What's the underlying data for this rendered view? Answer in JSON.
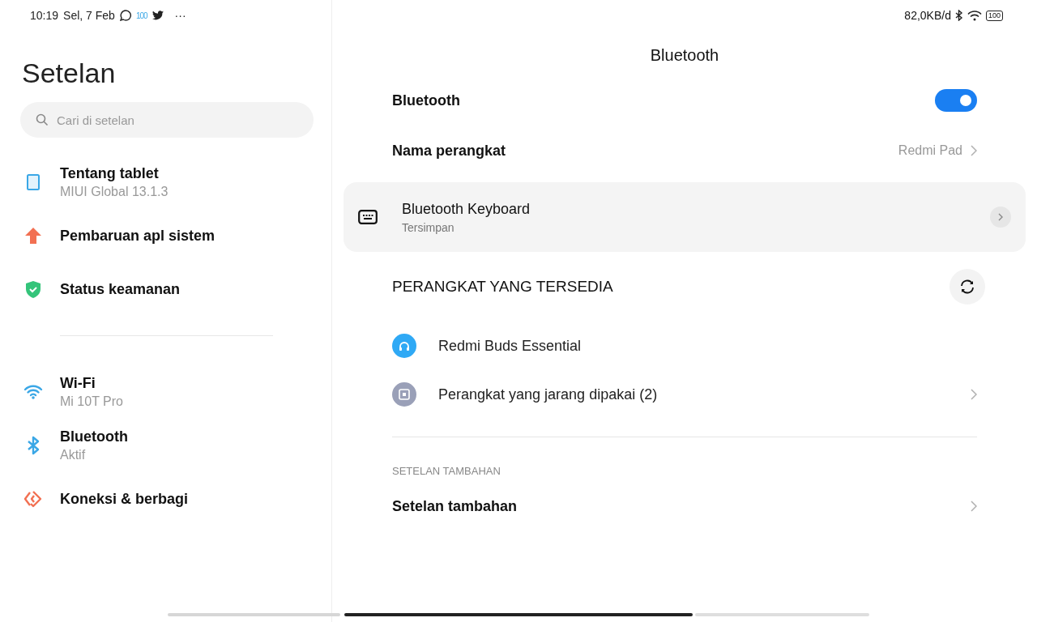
{
  "status_bar": {
    "time": "10:19",
    "date": "Sel, 7 Feb",
    "badge": "100",
    "more": "···",
    "speed": "82,0KB/d",
    "battery": "100"
  },
  "sidebar": {
    "title": "Setelan",
    "search": {
      "placeholder": "Cari di setelan"
    },
    "groups": [
      [
        {
          "kind": "tablet",
          "title": "Tentang tablet",
          "subtitle": "MIUI Global 13.1.3"
        },
        {
          "kind": "update",
          "title": "Pembaruan apl sistem"
        },
        {
          "kind": "security",
          "title": "Status keamanan"
        }
      ],
      [
        {
          "kind": "wifi",
          "title": "Wi-Fi",
          "subtitle": "Mi 10T Pro"
        },
        {
          "kind": "bluetooth",
          "title": "Bluetooth",
          "subtitle": "Aktif"
        },
        {
          "kind": "share",
          "title": "Koneksi & berbagi"
        }
      ]
    ]
  },
  "detail": {
    "title": "Bluetooth",
    "toggle": {
      "label": "Bluetooth",
      "on": true
    },
    "device_name": {
      "label": "Nama perangkat",
      "value": "Redmi Pad"
    },
    "saved_device": {
      "name": "Bluetooth Keyboard",
      "status": "Tersimpan"
    },
    "available_header": "PERANGKAT YANG TERSEDIA",
    "available": [
      {
        "kind": "headset",
        "name": "Redmi Buds Essential",
        "chevron": false
      },
      {
        "kind": "other",
        "name": "Perangkat yang jarang dipakai (2)",
        "chevron": true
      }
    ],
    "extra_header": "SETELAN TAMBAHAN",
    "extra": [
      {
        "label": "Setelan tambahan"
      }
    ]
  }
}
